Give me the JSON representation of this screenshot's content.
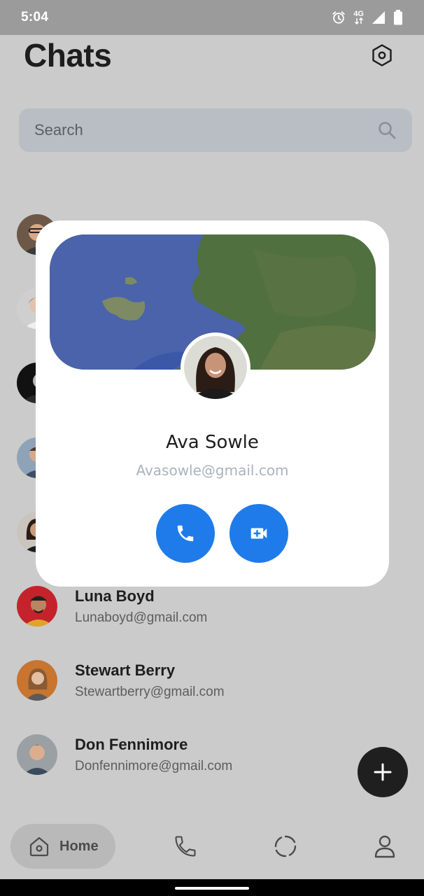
{
  "status_bar": {
    "time": "5:04",
    "network": "4G"
  },
  "header": {
    "title": "Chats"
  },
  "search": {
    "placeholder": "Search"
  },
  "contacts": [
    {
      "name": "",
      "email": ""
    },
    {
      "name": "",
      "email": ""
    },
    {
      "name": "",
      "email": ""
    },
    {
      "name": "",
      "email": ""
    },
    {
      "name": "",
      "email": ""
    },
    {
      "name": "Luna Boyd",
      "email": "Lunaboyd@gmail.com"
    },
    {
      "name": "Stewart Berry",
      "email": "Stewartberry@gmail.com"
    },
    {
      "name": "Don Fennimore",
      "email": "Donfennimore@gmail.com"
    }
  ],
  "profile_card": {
    "name": "Ava Sowle",
    "email": "Avasowle@gmail.com",
    "actions": [
      "phone-call",
      "video-call"
    ]
  },
  "bottom_nav": {
    "items": [
      {
        "label": "Home",
        "icon": "home-icon",
        "active": true
      },
      {
        "label": "",
        "icon": "phone-icon"
      },
      {
        "label": "",
        "icon": "status-circle-icon"
      },
      {
        "label": "",
        "icon": "profile-icon"
      }
    ]
  },
  "colors": {
    "accent": "#1f7bea",
    "fab": "#1f1f1f",
    "scrim_background": "#cbcbcb",
    "card": "#ffffff",
    "email_muted": "#a9b3c0"
  }
}
